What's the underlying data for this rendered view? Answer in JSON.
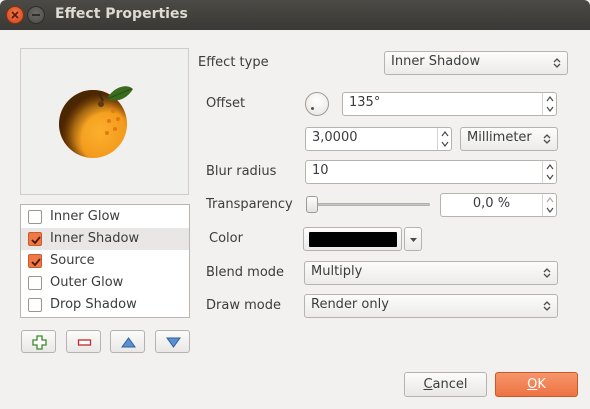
{
  "window": {
    "title": "Effect Properties"
  },
  "effects_list": {
    "items": [
      {
        "label": "Inner Glow",
        "checked": false,
        "selected": false
      },
      {
        "label": "Inner Shadow",
        "checked": true,
        "selected": true
      },
      {
        "label": "Source",
        "checked": true,
        "selected": false
      },
      {
        "label": "Outer Glow",
        "checked": false,
        "selected": false
      },
      {
        "label": "Drop Shadow",
        "checked": false,
        "selected": false
      }
    ]
  },
  "list_buttons": {
    "add": "add-effect",
    "remove": "remove-effect",
    "up": "move-up",
    "down": "move-down"
  },
  "properties": {
    "effect_type_label": "Effect type",
    "effect_type_value": "Inner Shadow",
    "offset_label": "Offset",
    "offset_angle": "135°",
    "offset_distance": "3,0000",
    "offset_unit": "Millimeter",
    "blur_radius_label": "Blur radius",
    "blur_radius_value": "10",
    "transparency_label": "Transparency",
    "transparency_value": "0,0 %",
    "transparency_fraction": 0.0,
    "color_label": "Color",
    "color_value": "#000000",
    "blend_mode_label": "Blend mode",
    "blend_mode_value": "Multiply",
    "draw_mode_label": "Draw mode",
    "draw_mode_value": "Render only"
  },
  "dialog_buttons": {
    "cancel_first": "C",
    "cancel_rest": "ancel",
    "ok_first": "O",
    "ok_rest": "K"
  },
  "colors": {
    "accent": "#f07746",
    "titlebar": "#3f3e3a",
    "orange_fruit": "#f39a1c",
    "leaf": "#3b6b1e"
  }
}
